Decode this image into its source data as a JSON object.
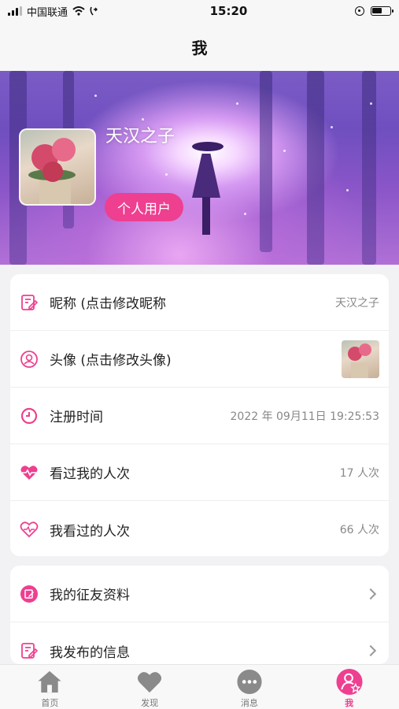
{
  "status_bar": {
    "carrier": "中国联通",
    "time": "15:20"
  },
  "nav": {
    "title": "我"
  },
  "profile": {
    "nickname": "天汉之子",
    "user_type": "个人用户"
  },
  "info_rows": [
    {
      "label": "昵称 (点击修改昵称",
      "value": "天汉之子",
      "icon": "edit-icon"
    },
    {
      "label": "头像 (点击修改头像)",
      "value": "",
      "icon": "user-icon"
    },
    {
      "label": "注册时间",
      "value": "2022 年 09月11日 19:25:53",
      "icon": "clock-icon"
    },
    {
      "label": "看过我的人次",
      "value": "17 人次",
      "icon": "heartbeat-icon"
    },
    {
      "label": "我看过的人次",
      "value": "66 人次",
      "icon": "heart-outline-icon"
    }
  ],
  "action_rows": [
    {
      "label": "我的征友资料",
      "icon": "profile-edit-icon"
    },
    {
      "label": "我发布的信息",
      "icon": "document-edit-icon"
    }
  ],
  "tabs": [
    {
      "label": "首页",
      "icon": "home-icon",
      "active": false
    },
    {
      "label": "发现",
      "icon": "heart-icon",
      "active": false
    },
    {
      "label": "消息",
      "icon": "chat-icon",
      "active": false
    },
    {
      "label": "我",
      "icon": "person-star-icon",
      "active": true
    }
  ],
  "colors": {
    "accent": "#ee3f90",
    "tab_inactive": "#8a8a8a"
  }
}
